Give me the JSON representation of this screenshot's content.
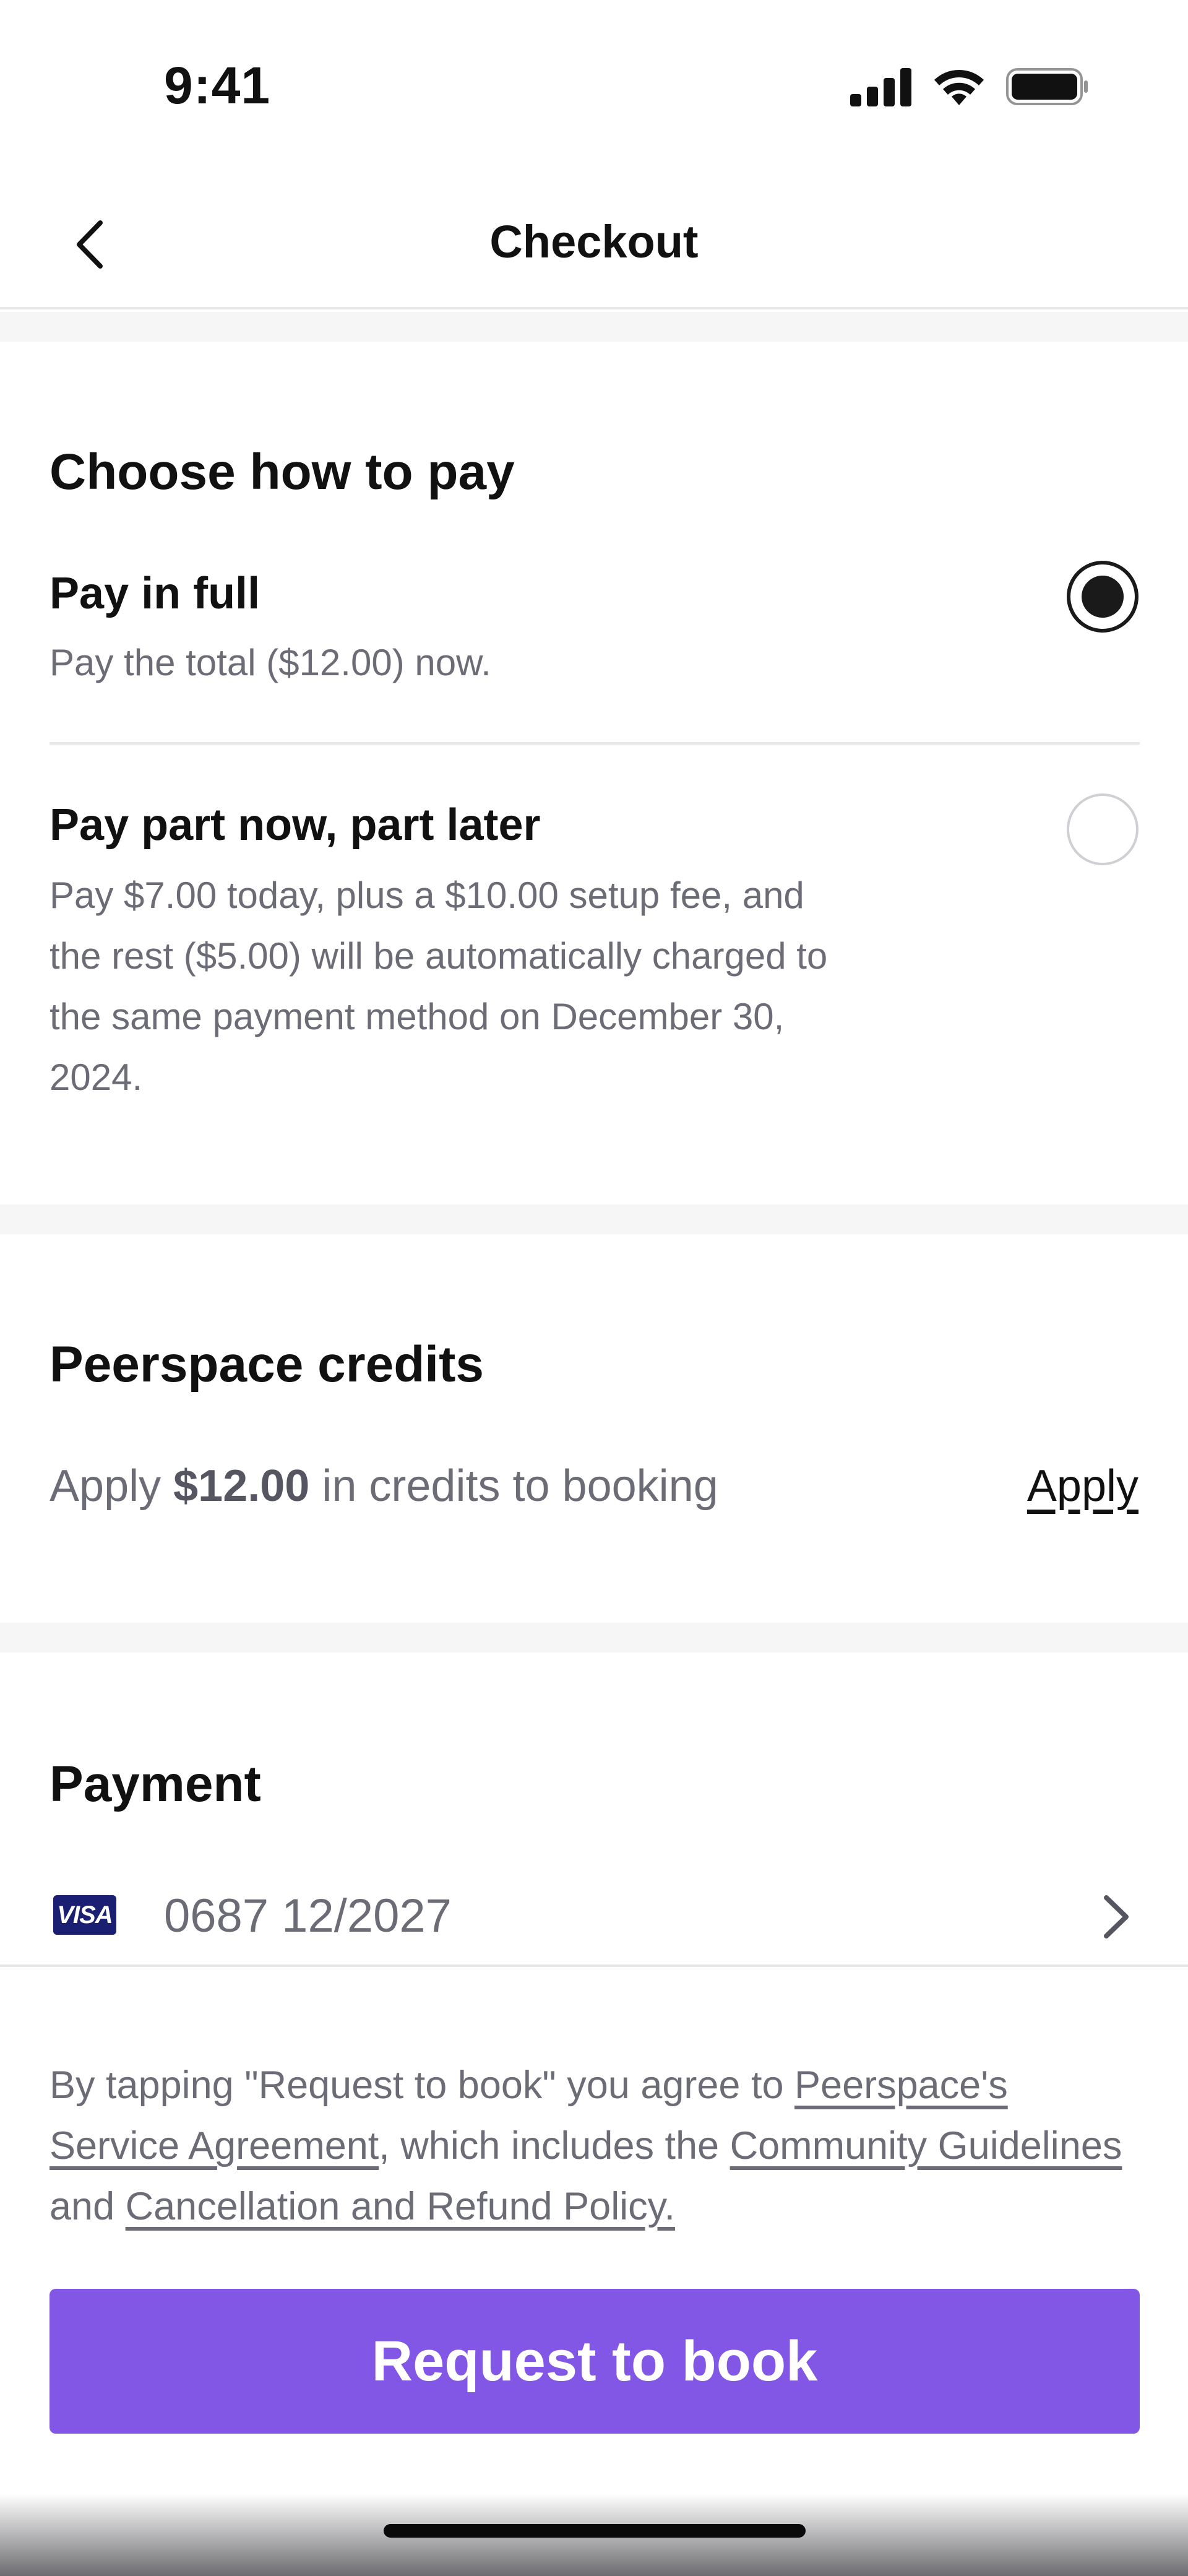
{
  "status_bar": {
    "time": "9:41",
    "icons": [
      "cellular-signal-icon",
      "wifi-icon",
      "battery-icon"
    ]
  },
  "nav": {
    "back_icon": "chevron-left-icon",
    "title": "Checkout"
  },
  "pay_options": {
    "heading": "Choose how to pay",
    "options": [
      {
        "title": "Pay in full",
        "description": "Pay the total ($12.00) now.",
        "selected": true
      },
      {
        "title": "Pay part now, part later",
        "description_lines": [
          "Pay $7.00 today, plus a $10.00 setup fee, and",
          "the rest ($5.00) will be automatically charged to",
          "the same payment method on December 30,",
          "2024."
        ],
        "selected": false
      }
    ]
  },
  "credits": {
    "heading": "Peerspace credits",
    "text_prefix": "Apply",
    "amount": "$12.00",
    "text_suffix": "in credits to booking",
    "apply_label": "Apply"
  },
  "payment": {
    "heading": "Payment",
    "card_brand": "VISA",
    "card_text": "0687 12/2027",
    "chevron_icon": "chevron-right-icon"
  },
  "legal": {
    "prefix": "By tapping \"Request to book\" you agree to",
    "link_service_agreement": "Peerspace's Service Agreement",
    "middle": ", which includes the",
    "link_community": "Community Guidelines",
    "and": "and",
    "link_cancellation": "Cancellation and Refund Policy."
  },
  "cta": {
    "label": "Request to book"
  },
  "colors": {
    "accent": "#8257e6",
    "text_primary": "#111111",
    "text_secondary": "#6b6c75",
    "visa_blue": "#1a1f71",
    "band_gray": "#f6f6f7"
  }
}
